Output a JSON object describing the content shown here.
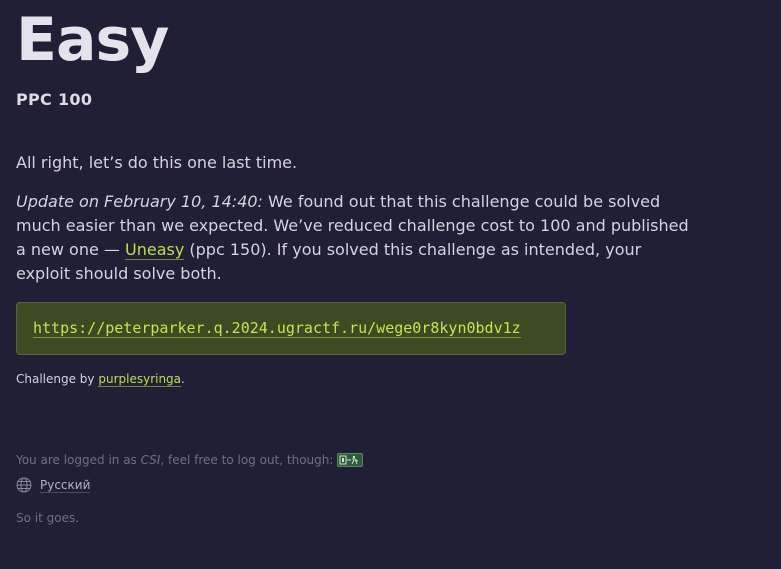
{
  "challenge": {
    "title": "Easy",
    "category": "PPC 100",
    "intro": "All right, let’s do this one last time.",
    "update": {
      "label": "Update on February 10, 14:40:",
      "text_before_link": " We found out that this challenge could be solved much easier than we expected. We’ve reduced challenge cost to 100 and published a new one — ",
      "link_text": "Uneasy",
      "text_after_link": " (ppc 150). If you solved this challenge as intended, your exploit should solve both."
    },
    "url": "https://peterparker.q.2024.ugractf.ru/wege0r8kyn0bdv1z",
    "author_prefix": "Challenge by ",
    "author": "purplesyringa",
    "author_suffix": "."
  },
  "footer": {
    "login_prefix": "You are logged in as ",
    "username": "CSI",
    "login_suffix": ", feel free to log out, though:",
    "logout_icon": "logout-icon",
    "language_icon": "globe-icon",
    "language_label": "Русский",
    "tagline": "So it goes."
  },
  "colors": {
    "background": "#201f35",
    "accent_green": "#b8e04a",
    "url_box_bg": "#3d4a22",
    "muted_text": "#6f6e85"
  }
}
